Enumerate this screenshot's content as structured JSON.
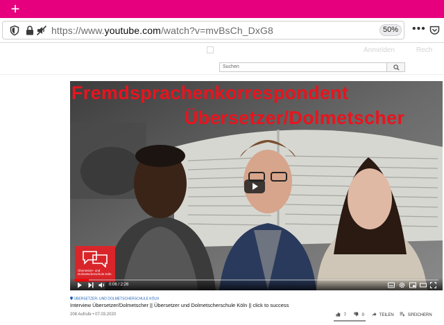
{
  "browser": {
    "url_prefix": "https://www.",
    "url_domain": "youtube.com",
    "url_path": "/watch?v=mvBsCh_DxG8",
    "zoom": "50%",
    "newtab_symbol": "+",
    "menu_symbol": "•••",
    "icons": [
      "shield-icon",
      "lock-icon",
      "autoplay-blocked-icon",
      "pocket-icon"
    ]
  },
  "youtube": {
    "search_placeholder": "Suchen",
    "background_header": [
      "Anmelden",
      "Rech"
    ]
  },
  "video": {
    "overlay_title_line1": "Fremdsprachenkorrespondent",
    "overlay_title_line2": "Übersetzer/Dolmetscher",
    "logo_caption": "Übersetzer- und Dolmetscherschule Köln",
    "time": "0:06 / 2:26",
    "progress": 0.04,
    "accent_color": "#e8141e"
  },
  "info": {
    "channel": "ÜBERSETZER- UND DOLMETSCHERSCHULE KÖLN",
    "title": "Interview Übersetzer/Dolmetscher || Übersetzer und Dolmetscherschule Köln || click to success",
    "views_date": "208 Aufrufe • 07.03.2020",
    "likes": "7",
    "dislikes": "0",
    "share_label": "TEILEN",
    "save_label": "SPEICHERN"
  }
}
